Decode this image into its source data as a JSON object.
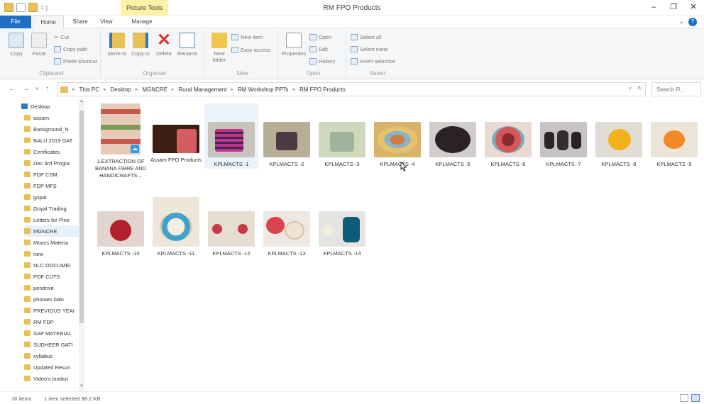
{
  "window": {
    "title": "RM FPO Products",
    "context_tab": "Picture Tools",
    "qat_separator": "= |"
  },
  "ribbon_tabs": {
    "file": "File",
    "home": "Home",
    "share": "Share",
    "view": "View",
    "manage": "Manage"
  },
  "ribbon": {
    "clipboard": {
      "label": "Clipboard",
      "copy": "Copy",
      "paste": "Paste",
      "cut": "Cut",
      "copy_path": "Copy path",
      "paste_shortcut": "Paste shortcut"
    },
    "organize": {
      "label": "Organize",
      "move_to": "Move to",
      "copy_to": "Copy to",
      "delete": "Delete",
      "rename": "Rename"
    },
    "new": {
      "label": "New",
      "new_folder": "New folder",
      "new_item": "New item",
      "easy_access": "Easy access"
    },
    "open": {
      "label": "Open",
      "properties": "Properties",
      "open": "Open",
      "edit": "Edit",
      "history": "History"
    },
    "select": {
      "label": "Select",
      "select_all": "Select all",
      "select_none": "Select none",
      "invert_selection": "Invert selection"
    }
  },
  "address": {
    "crumbs": [
      "This PC",
      "Desktop",
      "MGNCRE",
      "Rural Management",
      "RM Workshop PPTs",
      "RM FPO Products"
    ],
    "search_placeholder": "Search R..."
  },
  "nav_pane": {
    "items": [
      "Desktop",
      "assam",
      "Background_N",
      "BALU 2019 GAT",
      "Certificates",
      "Dec 3rd Progra",
      "FDP CSM",
      "FDP MFS",
      "gopal",
      "Goyal Trading",
      "Letters for Pine",
      "MGNCRE",
      "Moocs Materia",
      "new",
      "NLC DOCUMEI",
      "PDF CUTS",
      "pendrive",
      "photoes balu",
      "PREVIOUS YEAI",
      "RM FDP",
      "SAP MATERIAL",
      "SUDHEER GATI",
      "syllabus",
      "Updated Resun",
      "Video's Institut"
    ],
    "selected_index": 11
  },
  "files": [
    {
      "label": "1.EXTRACTION OF BANANA FIBRE AND HANDICRAFTS..."
    },
    {
      "label": "Assam FPO Products"
    },
    {
      "label": "KPLMACTS -1"
    },
    {
      "label": "KPLMACTS -2"
    },
    {
      "label": "KPLMACTS -3"
    },
    {
      "label": "KPLMACTS -4"
    },
    {
      "label": "KPLMACTS -5"
    },
    {
      "label": "KPLMACTS -6"
    },
    {
      "label": "KPLMACTS -7"
    },
    {
      "label": "KPLMACTS -8"
    },
    {
      "label": "KPLMACTS -9"
    },
    {
      "label": "KPLMACTS -10"
    },
    {
      "label": "KPLMACTS -11"
    },
    {
      "label": "KPLMACTS -12"
    },
    {
      "label": "KPLMACTS -13"
    },
    {
      "label": "KPLMACTS -14"
    }
  ],
  "status": {
    "item_count": "16 items",
    "selection": "1 item selected  98.2 KB"
  },
  "colors": {
    "file_tab": "#1f6fc5",
    "context_tab": "#fbf2a8",
    "selection": "#e5f1fb"
  },
  "icons": {
    "window": [
      "folder-icon",
      "document-icon",
      "minimize-icon",
      "maximize-icon",
      "close-icon"
    ],
    "ribbon": [
      "copy-icon",
      "paste-icon",
      "cut-icon",
      "move-to-icon",
      "copy-to-icon",
      "delete-icon",
      "rename-icon",
      "new-folder-icon",
      "properties-icon"
    ]
  }
}
